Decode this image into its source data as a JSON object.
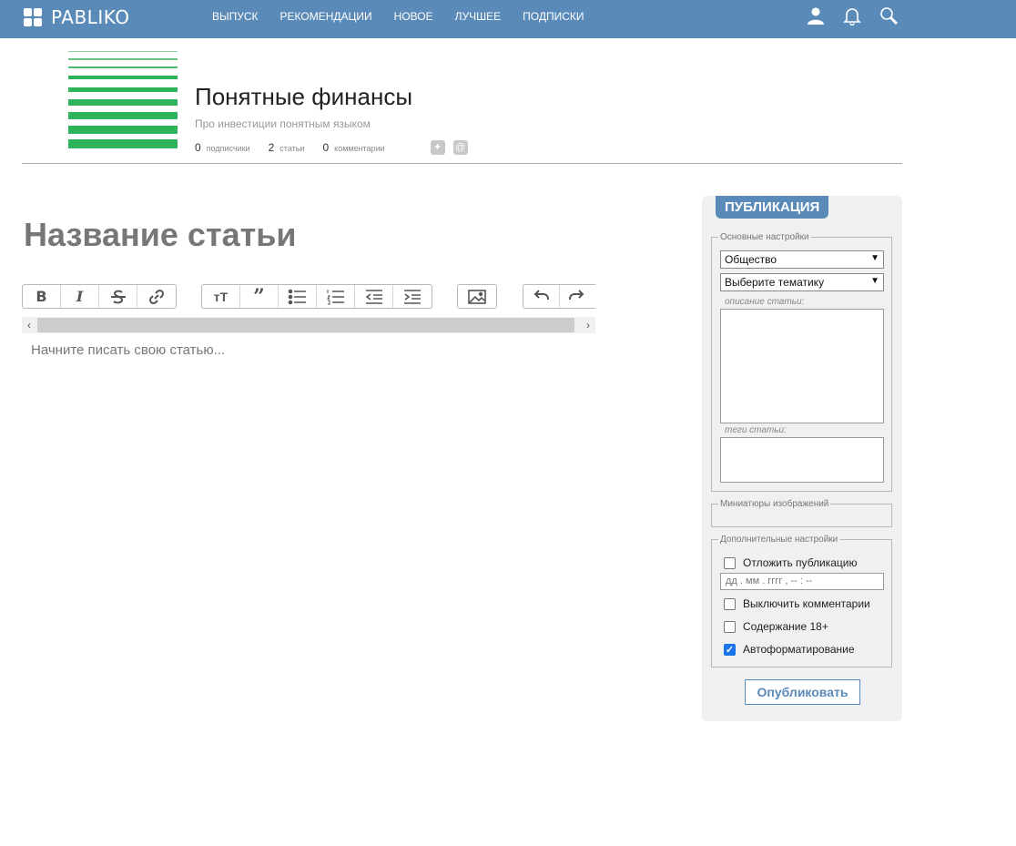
{
  "app": {
    "name": "PABLIKO"
  },
  "nav": [
    {
      "label": "ВЫПУСК"
    },
    {
      "label": "РЕКОМЕНДАЦИИ"
    },
    {
      "label": "НОВОЕ"
    },
    {
      "label": "ЛУЧШЕЕ"
    },
    {
      "label": "ПОДПИСКИ"
    }
  ],
  "top_icons": [
    "user-icon",
    "bell-icon",
    "search-icon"
  ],
  "channel": {
    "title": "Понятные финансы",
    "description": "Про инвестиции понятным языком",
    "stats": [
      {
        "count": "0",
        "label": "подписчики"
      },
      {
        "count": "2",
        "label": "статьи"
      },
      {
        "count": "0",
        "label": "комментарии"
      }
    ],
    "badges": [
      "✦",
      "@"
    ],
    "logo_color": "#2eb35a"
  },
  "editor": {
    "title_placeholder": "Название статьи",
    "body_placeholder": "Начните писать свою статью...",
    "toolbar_icons": [
      "bold-icon",
      "italic-icon",
      "strikethrough-icon",
      "link-icon",
      "heading-icon",
      "quote-icon",
      "bulleted-list-icon",
      "numbered-list-icon",
      "outdent-icon",
      "indent-icon",
      "image-icon",
      "undo-icon",
      "redo-icon"
    ]
  },
  "panel": {
    "header": "ПУБЛИКАЦИЯ",
    "basic_legend": "Основные настройки",
    "category_value": "Общество",
    "topic_value": "Выберите тематику",
    "description_label": "описание статьи:",
    "tags_label": "теги статьи:",
    "thumbs_legend": "Миниатюры изображений",
    "extra_legend": "Дополнительные настройки",
    "postpone_label": "Отложить публикацию",
    "datetime_placeholder": "дд . мм . гггг ,  -- : --",
    "disable_comments_label": "Выключить комментарии",
    "adult_label": "Содержание 18+",
    "autoformat_label": "Автоформатирование",
    "autoformat_checked": true,
    "publish_label": "Опубликовать"
  },
  "colors": {
    "brand": "#5a8ab8",
    "accent_green": "#2eb35a"
  }
}
